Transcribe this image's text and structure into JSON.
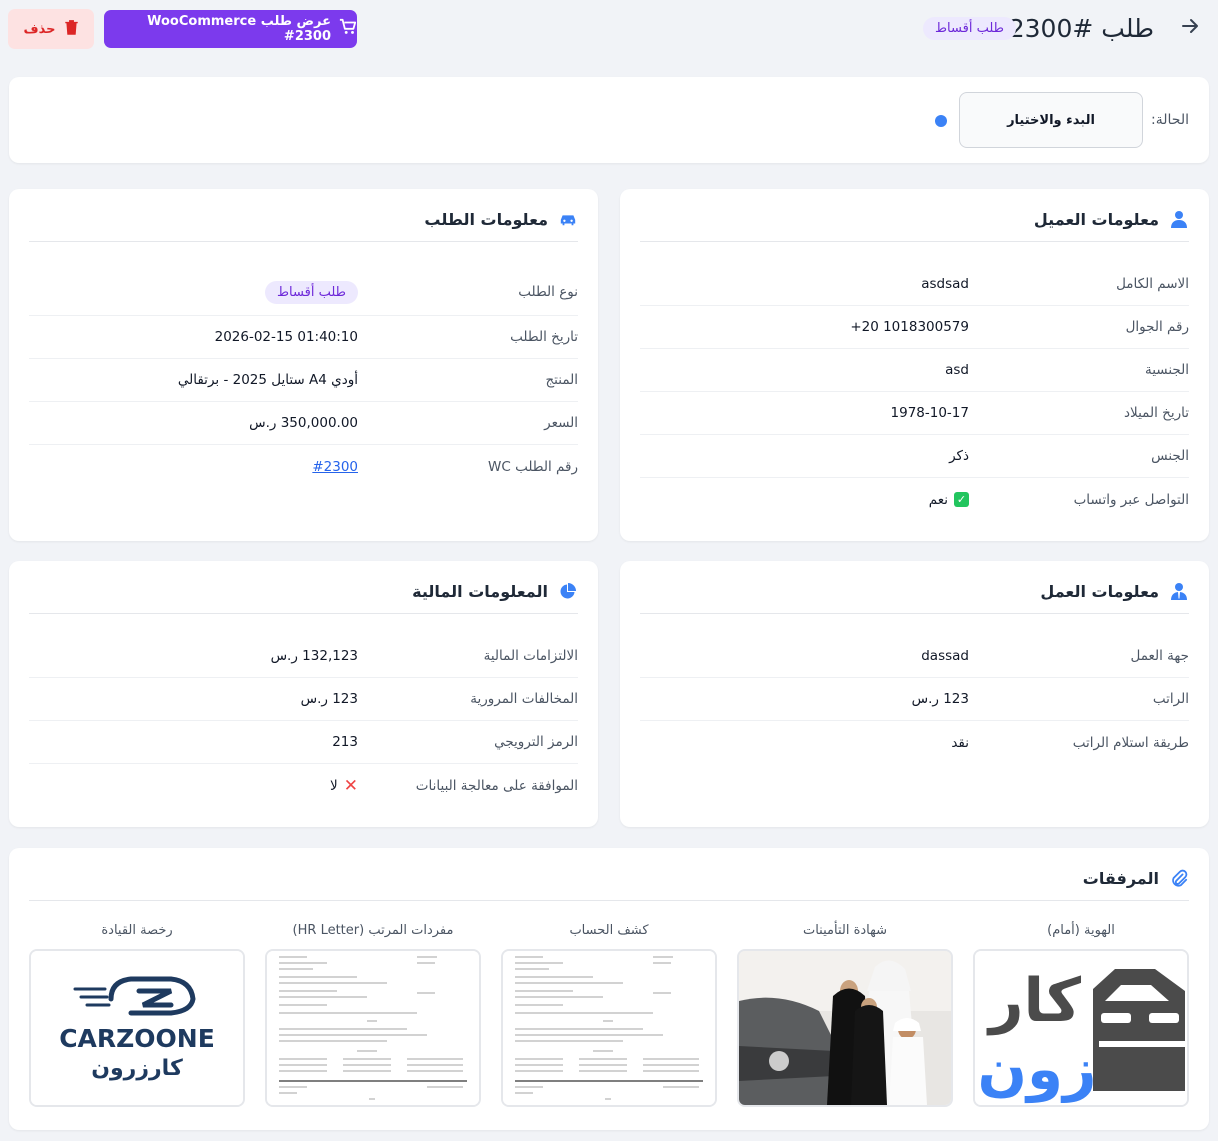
{
  "header": {
    "title": "طلب #2300",
    "type_badge": "طلب أقساط",
    "wc_button": "عرض طلب WooCommerce #2300",
    "delete_button": "حذف"
  },
  "status": {
    "label": "الحالة:",
    "value": "البدء والاختيار",
    "dot_color": "#3b82f6"
  },
  "customer": {
    "title": "معلومات العميل",
    "rows": [
      {
        "label": "الاسم الكامل",
        "value": "asdsad"
      },
      {
        "label": "رقم الجوال",
        "value": "+20 1018300579"
      },
      {
        "label": "الجنسية",
        "value": "asd"
      },
      {
        "label": "تاريخ الميلاد",
        "value": "1978-10-17"
      },
      {
        "label": "الجنس",
        "value": "ذكر"
      },
      {
        "label": "التواصل عبر واتساب",
        "value": "نعم"
      }
    ]
  },
  "order": {
    "title": "معلومات الطلب",
    "rows": [
      {
        "label": "نوع الطلب",
        "value": "طلب أقساط"
      },
      {
        "label": "تاريخ الطلب",
        "value": "2026-02-15 01:40:10"
      },
      {
        "label": "المنتج",
        "value": "أودي A4 ستايل 2025 - برتقالي"
      },
      {
        "label": "السعر",
        "value": "350,000.00 ر.س"
      },
      {
        "label": "رقم الطلب WC",
        "value": "#2300"
      }
    ]
  },
  "work": {
    "title": "معلومات العمل",
    "rows": [
      {
        "label": "جهة العمل",
        "value": "dassad"
      },
      {
        "label": "الراتب",
        "value": "123 ر.س"
      },
      {
        "label": "طريقة استلام الراتب",
        "value": "نقد"
      }
    ]
  },
  "financial": {
    "title": "المعلومات المالية",
    "rows": [
      {
        "label": "الالتزامات المالية",
        "value": "132,123 ر.س"
      },
      {
        "label": "المخالفات المرورية",
        "value": "123 ر.س"
      },
      {
        "label": "الرمز الترويجي",
        "value": "213"
      },
      {
        "label": "الموافقة على معالجة البيانات",
        "value": "لا"
      }
    ]
  },
  "attachments": {
    "title": "المرفقات",
    "items": [
      {
        "label": "الهوية (أمام)"
      },
      {
        "label": "شهادة التأمينات"
      },
      {
        "label": "كشف الحساب"
      },
      {
        "label": "مفردات المرتب (HR Letter)"
      },
      {
        "label": "رخصة القيادة"
      }
    ],
    "logo_text_en": "CARZOONE",
    "logo_text_ar": "كارزرون",
    "big_logo_ar_top": "كار",
    "big_logo_ar_bottom": "زون"
  },
  "colors": {
    "accent": "#7c3aed",
    "primary_blue": "#3b82f6",
    "danger": "#dc2626",
    "brand_navy": "#1e3a5f"
  }
}
